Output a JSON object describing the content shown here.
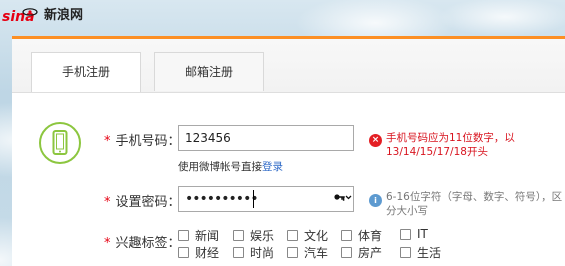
{
  "brand": {
    "logo_text": "新浪网"
  },
  "tabs": [
    {
      "label": "手机注册",
      "active": true
    },
    {
      "label": "邮箱注册",
      "active": false
    }
  ],
  "form": {
    "phone": {
      "required_mark": "*",
      "label": "手机号码：",
      "value": "123456",
      "helper_prefix": "使用微博帐号直接",
      "helper_link": "登录",
      "error_line1": "手机号码应为11位数字，以",
      "error_line2": "13/14/15/17/18开头"
    },
    "password": {
      "required_mark": "*",
      "label": "设置密码：",
      "value": "••••••••••",
      "hint_line1": "6-16位字符（字母、数字、符号），区",
      "hint_line2": "分大小写"
    },
    "interests": {
      "required_mark": "*",
      "label": "兴趣标签：",
      "items": [
        "新闻",
        "娱乐",
        "文化",
        "体育",
        "IT",
        "财经",
        "时尚",
        "汽车",
        "房产",
        "生活"
      ]
    }
  },
  "colors": {
    "accent": "#fc8f24",
    "required": "#e60012",
    "error": "#d8141f",
    "info": "#5d9ad0",
    "phone_icon": "#8cc63f",
    "link": "#2f6ac7"
  }
}
